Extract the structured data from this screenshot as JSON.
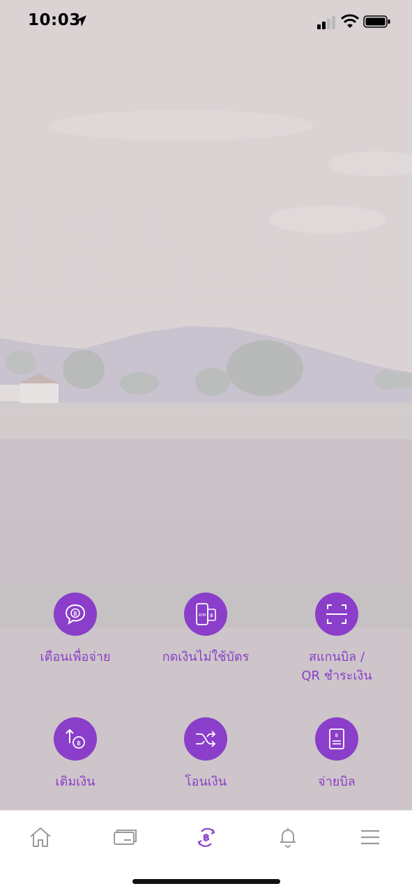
{
  "status_bar": {
    "time": "10:03"
  },
  "actions": [
    {
      "label": "เตือนเพื่อจ่าย",
      "icon": "chat-baht-icon"
    },
    {
      "label": "กดเงินไม่ใช้บัตร",
      "icon": "atm-phone-icon",
      "icon_text": "ATM"
    },
    {
      "label": "สแกนบิล /\nQR ชำระเงิน",
      "icon": "scan-icon"
    },
    {
      "label": "เติมเงิน",
      "icon": "topup-icon"
    },
    {
      "label": "โอนเงิน",
      "icon": "transfer-icon"
    },
    {
      "label": "จ่ายบิล",
      "icon": "bill-icon"
    }
  ],
  "tab_bar": {
    "items": [
      "home-icon",
      "cards-icon",
      "transaction-icon",
      "bell-icon",
      "menu-icon"
    ],
    "active": "transaction-icon"
  },
  "colors": {
    "accent": "#8a3ec9",
    "tab_inactive": "#9a9a9a",
    "background": "#dcd4d5"
  }
}
